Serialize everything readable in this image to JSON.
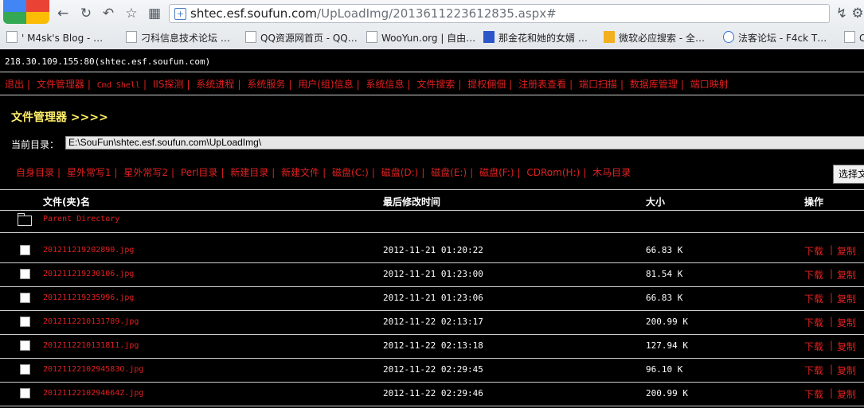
{
  "browser": {
    "url_host": "shtec.esf.soufun.com",
    "url_rest": "/UpLoadImg/2013611223612835.aspx#",
    "bookmarks": [
      "' M4sk's Blog - …",
      "刁科信息技术论坛 …",
      "QQ资源网首页 - QQ…",
      "WooYun.org | 自由…",
      "那金花和她的女婿 …",
      "微软必应搜索 - 全…",
      "法客论坛 - F4ck T…",
      "C:"
    ]
  },
  "page": {
    "host_line": "218.30.109.155:80(shtec.esf.soufun.com)",
    "menu": [
      "退出",
      "文件管理器",
      "Cmd Shell",
      "IIS探测",
      "系统进程",
      "系统服务",
      "用户(组)信息",
      "系统信息",
      "文件搜索",
      "提权佣佃",
      "注册表查看",
      "端口扫描",
      "数据库管理",
      "端口映射"
    ],
    "fm_title": "文件管理器 >>>>",
    "curdir_label": "当前目录：",
    "curdir_value": "E:\\SouFun\\shtec.esf.soufun.com\\UpLoadImg\\",
    "toolbar": [
      "自身目录",
      "星外常写1",
      "星外常写2",
      "Perl目录",
      "新建目录",
      "新建文件",
      "磁盘(C:)",
      "磁盘(D:)",
      "磁盘(E:)",
      "磁盘(F:)",
      "CDRom(H:)",
      "木马目录"
    ],
    "choose_button": "选择文",
    "table": {
      "headers": [
        "文件(夹)名",
        "最后修改时间",
        "大小",
        "操作"
      ],
      "parent_directory": "Parent Directory",
      "rows": [
        {
          "name": "201211219202890.jpg",
          "modified": "2012-11-21 01:20:22",
          "size": "66.83 K"
        },
        {
          "name": "201211219230106.jpg",
          "modified": "2012-11-21 01:23:00",
          "size": "81.54 K"
        },
        {
          "name": "201211219235996.jpg",
          "modified": "2012-11-21 01:23:06",
          "size": "66.83 K"
        },
        {
          "name": "2012112210131789.jpg",
          "modified": "2012-11-22 02:13:17",
          "size": "200.99 K"
        },
        {
          "name": "2012112210131811.jpg",
          "modified": "2012-11-22 02:13:18",
          "size": "127.94 K"
        },
        {
          "name": "2012112210294583O.jpg",
          "modified": "2012-11-22 02:29:45",
          "size": "96.10 K"
        },
        {
          "name": "2012112210294664Z.jpg",
          "modified": "2012-11-22 02:29:46",
          "size": "200.99 K"
        }
      ],
      "action_download": "下载",
      "action_separator": "|",
      "action_copy": "复制"
    }
  },
  "colors": {
    "link_red": "#e02020",
    "title_yellow": "#ffef6a",
    "background": "#000000"
  }
}
